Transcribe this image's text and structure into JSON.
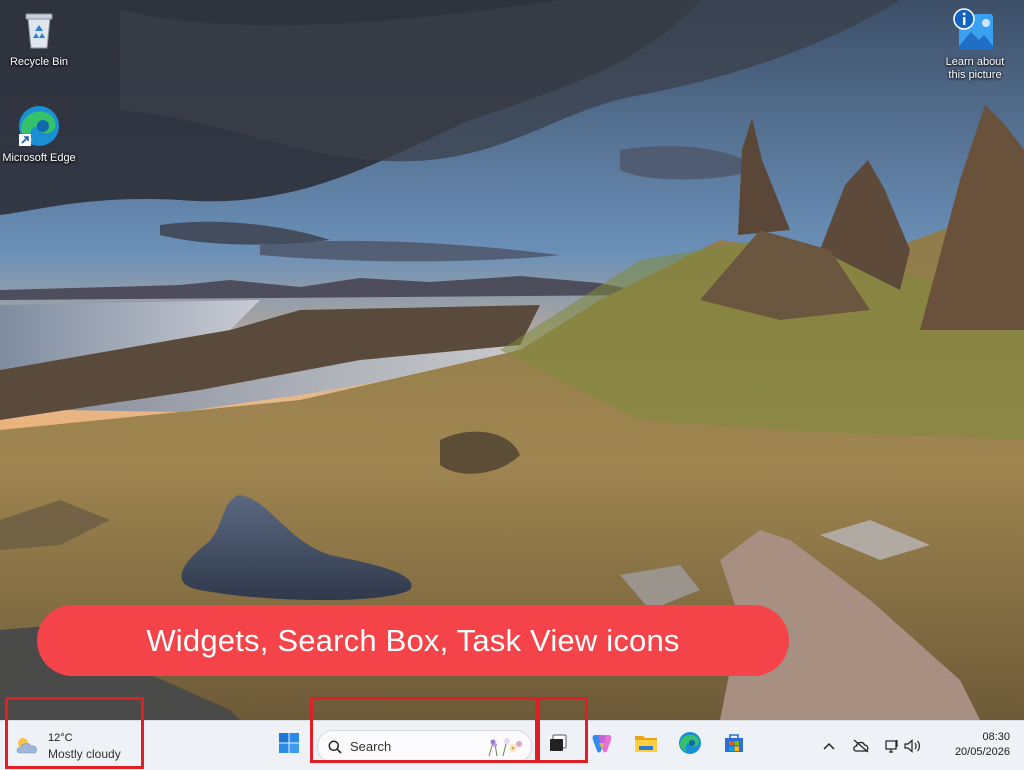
{
  "desktop": {
    "icons": [
      {
        "label": "Recycle Bin",
        "icon": "recycle-bin-icon"
      },
      {
        "label": "Microsoft Edge",
        "icon": "edge-icon"
      },
      {
        "label": "Learn about this picture",
        "icon": "learn-about-picture-icon"
      }
    ]
  },
  "banner": {
    "text": "Widgets, Search Box, Task View icons"
  },
  "taskbar": {
    "weather": {
      "temp": "12°C",
      "condition": "Mostly cloudy",
      "icon": "cloud-sun-icon"
    },
    "search": {
      "placeholder": "Search"
    },
    "apps": [
      "start-icon",
      "task-view-icon",
      "copilot-icon",
      "file-explorer-icon",
      "edge-icon",
      "microsoft-store-icon"
    ],
    "tray": [
      "chevron-up-icon",
      "cloud-offline-icon",
      "network-icon",
      "volume-icon"
    ],
    "clock": {
      "time": "08:30",
      "date": "20/05/2026"
    }
  },
  "colors": {
    "highlight": "#e01f25",
    "banner": "#f4444a",
    "taskbar": "#eef1f6"
  }
}
